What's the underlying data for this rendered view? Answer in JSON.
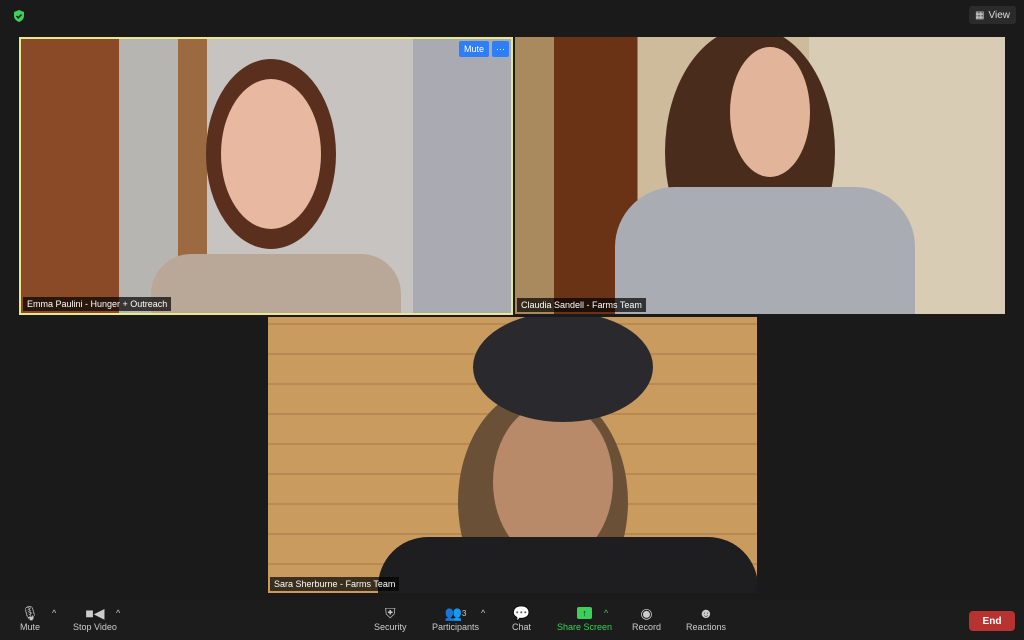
{
  "header": {
    "view_label": "View"
  },
  "tiles": [
    {
      "name": "Emma Paulini - Hunger + Outreach",
      "mute": "Mute",
      "more": "···"
    },
    {
      "name": "Claudia Sandell - Farms Team"
    },
    {
      "name": "Sara Sherburne - Farms Team"
    }
  ],
  "toolbar": {
    "mute": "Mute",
    "stop_video": "Stop Video",
    "security": "Security",
    "participants": "Participants",
    "participant_count": "3",
    "chat": "Chat",
    "share_screen": "Share Screen",
    "record": "Record",
    "reactions": "Reactions",
    "end": "End"
  },
  "colors": {
    "active_speaker": "#e8e88e",
    "accent": "#2d7ef7",
    "share": "#3ecf5a",
    "end": "#b73332"
  }
}
